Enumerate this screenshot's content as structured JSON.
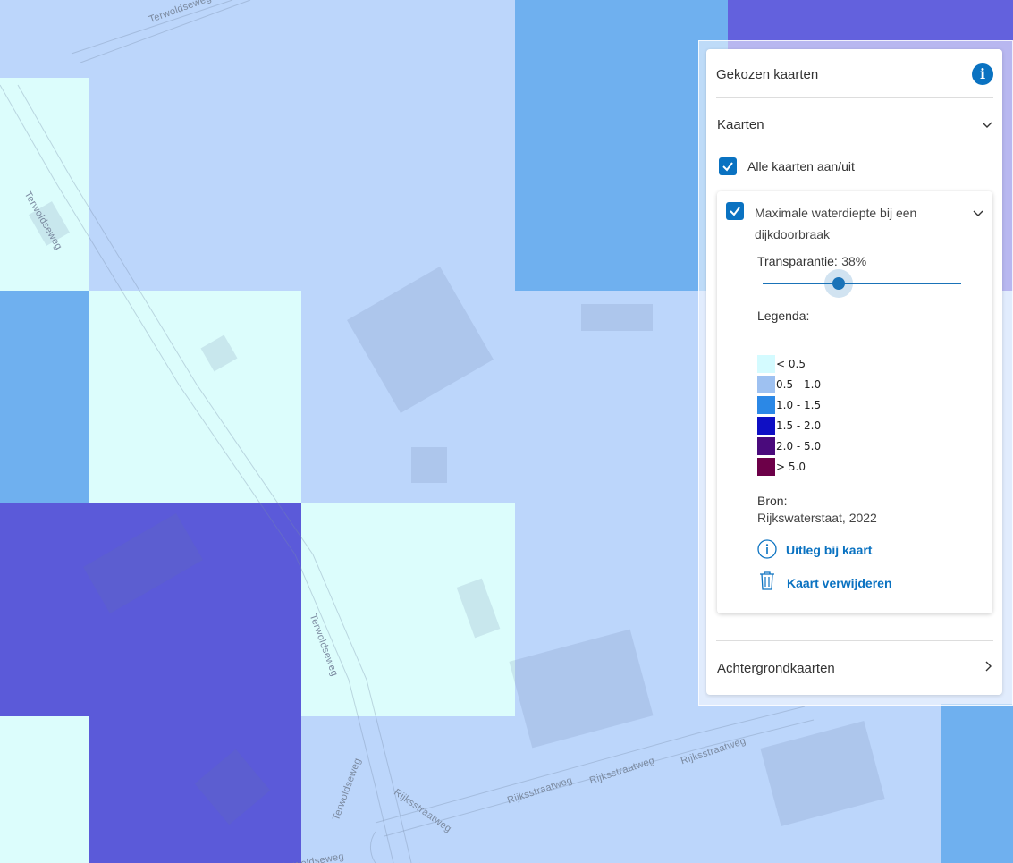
{
  "map": {
    "road_labels": [
      "Terwoldseweg",
      "Terwoldseweg",
      "Terwoldseweg",
      "Terwoldseweg",
      "Terwoldseweg",
      "Rijksstraatweg",
      "Rijksstraatweg",
      "Rijksstraatweg",
      "Rijksstraatweg",
      "Terwoldseweg"
    ],
    "colors": {
      "base": "#bcd6fb",
      "lightest": "#dcfdfc",
      "medium": "#6fb0ef",
      "dark": "#5b5ad9",
      "legend_lt05": "#d4fbff",
      "legend_05_10": "#9ec1f1",
      "legend_10_15": "#2b88e6",
      "legend_15_20": "#0f0fc4",
      "legend_20_50": "#4a0a7c",
      "legend_gt50": "#6c0048",
      "accent": "#0a72c1"
    }
  },
  "panel": {
    "title": "Gekozen kaarten",
    "info_icon": "i",
    "maps_section": "Kaarten",
    "toggle_all_label": "Alle kaarten aan/uit",
    "layer": {
      "name": "Maximale waterdiepte bij een dijkdoorbraak",
      "transparency_label": "Transparantie:",
      "transparency_value": "38%",
      "transparency_fraction": 0.38,
      "legend_label": "Legenda:",
      "legend": [
        {
          "label": "< 0.5",
          "color": "#d4fbff"
        },
        {
          "label": "0.5 - 1.0",
          "color": "#9ec1f1"
        },
        {
          "label": "1.0 - 1.5",
          "color": "#2b88e6"
        },
        {
          "label": "1.5 - 2.0",
          "color": "#0f0fc4"
        },
        {
          "label": "2.0 - 5.0",
          "color": "#4a0a7c"
        },
        {
          "label": "> 5.0",
          "color": "#6c0048"
        }
      ],
      "source_label": "Bron:",
      "source_value": "Rijkswaterstaat, 2022",
      "explain_link": "Uitleg bij kaart",
      "remove_link": "Kaart verwijderen"
    },
    "background_section": "Achtergrondkaarten"
  }
}
